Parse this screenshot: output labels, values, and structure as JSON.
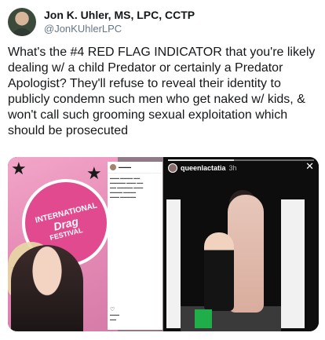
{
  "tweet": {
    "display_name": "Jon K. Uhler, MS, LPC, CCTP",
    "handle": "@JonKUhlerLPC",
    "text": "What's the #4 RED FLAG INDICATOR that you're likely dealing w/ a child Predator or certainly a Predator Apologist? They'll refuse to reveal their identity to publicly condemn such men who get naked w/ kids, & won't call such grooming sexual exploitation which should be prosecuted"
  },
  "media": {
    "left": {
      "poster_line1": "INTERNATIONAL",
      "poster_line2": "Drag",
      "poster_line3": "FESTIVAL"
    },
    "right": {
      "story_user": "queenlactatia",
      "story_time": "3h",
      "close_symbol": "✕"
    }
  },
  "icons": [
    "avatar",
    "star-icon",
    "heart-icon",
    "close-icon"
  ],
  "colors": {
    "text": "#14171a",
    "secondary_text": "#657786",
    "poster_pink": "#e14a8f"
  }
}
